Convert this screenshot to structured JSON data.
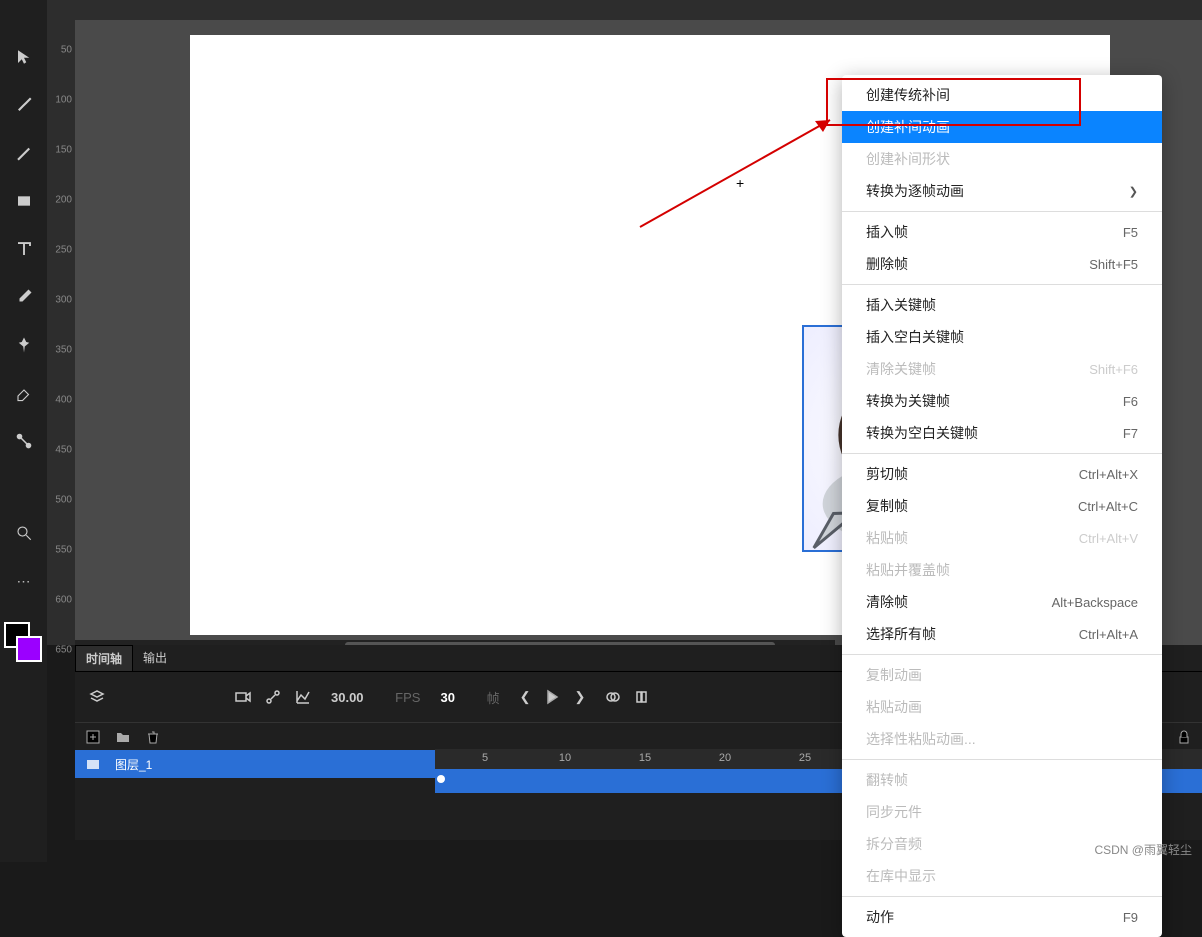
{
  "toolbar": {
    "tools": [
      "selection-tool",
      "brush-tool",
      "pen-tool",
      "rectangle-tool",
      "text-tool",
      "eyedropper-tool",
      "pin-tool",
      "eraser-tool",
      "bone-tool"
    ],
    "swatch_primary": "#000000",
    "swatch_secondary": "#9b00ff"
  },
  "ruler_v": [
    "50",
    "100",
    "150",
    "200",
    "250",
    "300",
    "350",
    "400",
    "450",
    "500",
    "550",
    "600",
    "650"
  ],
  "ruler_h": [],
  "context_menu": {
    "groups": [
      [
        {
          "label": "创建传统补间",
          "shortcut": "",
          "enabled": true,
          "highlighted": false
        },
        {
          "label": "创建补间动画",
          "shortcut": "",
          "enabled": true,
          "highlighted": true
        },
        {
          "label": "创建补间形状",
          "shortcut": "",
          "enabled": false,
          "highlighted": false
        },
        {
          "label": "转换为逐帧动画",
          "shortcut": "",
          "enabled": true,
          "highlighted": false,
          "submenu": true
        }
      ],
      [
        {
          "label": "插入帧",
          "shortcut": "F5",
          "enabled": true
        },
        {
          "label": "删除帧",
          "shortcut": "Shift+F5",
          "enabled": true
        }
      ],
      [
        {
          "label": "插入关键帧",
          "shortcut": "",
          "enabled": true
        },
        {
          "label": "插入空白关键帧",
          "shortcut": "",
          "enabled": true
        },
        {
          "label": "清除关键帧",
          "shortcut": "Shift+F6",
          "enabled": false
        },
        {
          "label": "转换为关键帧",
          "shortcut": "F6",
          "enabled": true
        },
        {
          "label": "转换为空白关键帧",
          "shortcut": "F7",
          "enabled": true
        }
      ],
      [
        {
          "label": "剪切帧",
          "shortcut": "Ctrl+Alt+X",
          "enabled": true
        },
        {
          "label": "复制帧",
          "shortcut": "Ctrl+Alt+C",
          "enabled": true
        },
        {
          "label": "粘贴帧",
          "shortcut": "Ctrl+Alt+V",
          "enabled": false
        },
        {
          "label": "粘贴并覆盖帧",
          "shortcut": "",
          "enabled": false
        },
        {
          "label": "清除帧",
          "shortcut": "Alt+Backspace",
          "enabled": true
        },
        {
          "label": "选择所有帧",
          "shortcut": "Ctrl+Alt+A",
          "enabled": true
        }
      ],
      [
        {
          "label": "复制动画",
          "shortcut": "",
          "enabled": false
        },
        {
          "label": "粘贴动画",
          "shortcut": "",
          "enabled": false
        },
        {
          "label": "选择性粘贴动画...",
          "shortcut": "",
          "enabled": false
        }
      ],
      [
        {
          "label": "翻转帧",
          "shortcut": "",
          "enabled": false
        },
        {
          "label": "同步元件",
          "shortcut": "",
          "enabled": false
        },
        {
          "label": "拆分音频",
          "shortcut": "",
          "enabled": false
        },
        {
          "label": "在库中显示",
          "shortcut": "",
          "enabled": false
        }
      ],
      [
        {
          "label": "动作",
          "shortcut": "F9",
          "enabled": true
        }
      ]
    ]
  },
  "timeline": {
    "tabs": {
      "timeline": "时间轴",
      "output": "输出"
    },
    "fps_value": "30.00",
    "fps_label": "FPS",
    "frame_value": "30",
    "frame_label": "帧",
    "layer_name": "图层_1",
    "marks": [
      "5",
      "10",
      "15",
      "20",
      "25"
    ]
  },
  "watermark": "CSDN @雨翼轻尘"
}
